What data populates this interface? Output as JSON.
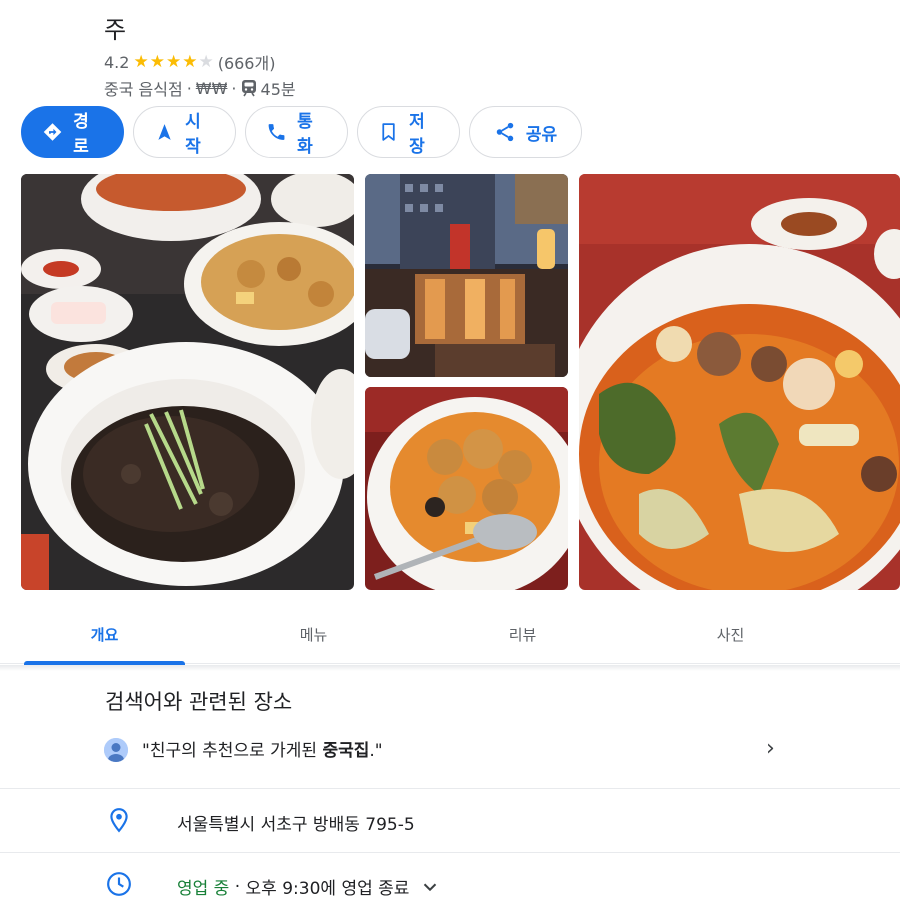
{
  "place": {
    "name": "주",
    "rating": "4.2",
    "stars": 4,
    "review_count": "(666개)",
    "category": "중국 음식점",
    "price": "₩₩",
    "transit_time": "45분"
  },
  "actions": [
    {
      "label": "경로",
      "icon": "directions-icon"
    },
    {
      "label": "시작",
      "icon": "navigation-arrow-icon"
    },
    {
      "label": "통화",
      "icon": "phone-icon"
    },
    {
      "label": "저장",
      "icon": "bookmark-icon"
    },
    {
      "label": "공유",
      "icon": "share-icon"
    }
  ],
  "tabs": [
    {
      "label": "개요",
      "active": true
    },
    {
      "label": "메뉴",
      "active": false
    },
    {
      "label": "리뷰",
      "active": false
    },
    {
      "label": "사진",
      "active": false
    }
  ],
  "related": {
    "title": "검색어와 관련된 장소",
    "quote_prefix": "\"친구의 추천으로 가게된 ",
    "quote_bold": "중국집",
    "quote_suffix": ".\""
  },
  "address": "서울특별시 서초구 방배동 795-5",
  "hours": {
    "status": "영업 중",
    "separator": " · ",
    "closing": "오후 9:30에 영업 종료"
  },
  "colors": {
    "accent": "#1a73e8",
    "open": "#188038",
    "star": "#fbbc04"
  }
}
